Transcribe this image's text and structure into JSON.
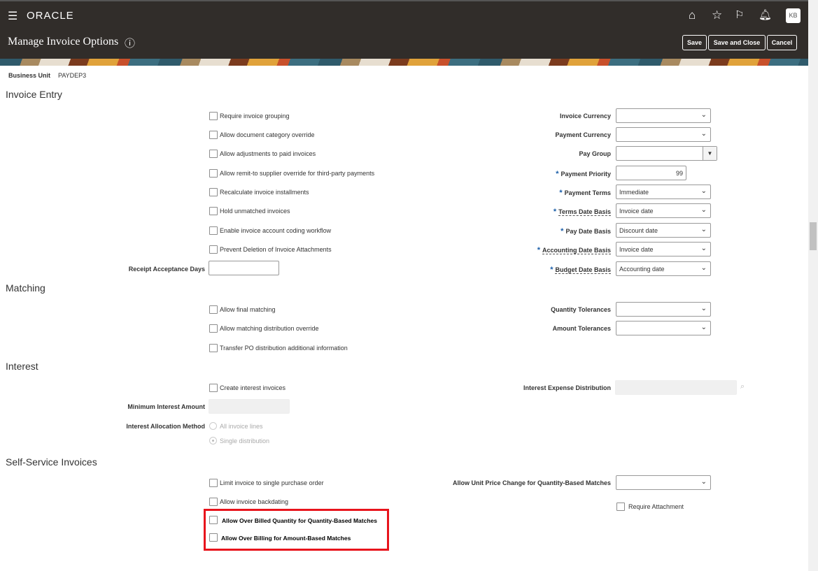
{
  "header": {
    "brand": "ORACLE",
    "title": "Manage Invoice Options",
    "avatar": "KB",
    "buttons": {
      "save": "Save",
      "save_close": "Save and Close",
      "cancel": "Cancel"
    }
  },
  "business_unit": {
    "label": "Business Unit",
    "value": "PAYDEP3"
  },
  "invoice_entry": {
    "title": "Invoice Entry",
    "checkboxes": [
      "Require invoice grouping",
      "Allow document category override",
      "Allow adjustments to paid invoices",
      "Allow remit-to supplier override for third-party payments",
      "Recalculate invoice installments",
      "Hold unmatched invoices",
      "Enable invoice account coding workflow",
      "Prevent Deletion of Invoice Attachments"
    ],
    "receipt_acceptance_days": {
      "label": "Receipt Acceptance Days",
      "value": ""
    },
    "fields": [
      {
        "label": "Invoice Currency",
        "value": "",
        "required": false
      },
      {
        "label": "Payment Currency",
        "value": "",
        "required": false
      },
      {
        "label": "Pay Group",
        "value": "",
        "required": false
      },
      {
        "label": "Payment Priority",
        "value": "99",
        "required": true
      },
      {
        "label": "Payment Terms",
        "value": "Immediate",
        "required": true
      },
      {
        "label": "Terms Date Basis",
        "value": "Invoice date",
        "required": true
      },
      {
        "label": "Pay Date Basis",
        "value": "Discount date",
        "required": true
      },
      {
        "label": "Accounting Date Basis",
        "value": "Invoice date",
        "required": true
      },
      {
        "label": "Budget Date Basis",
        "value": "Accounting date",
        "required": true
      }
    ]
  },
  "matching": {
    "title": "Matching",
    "checkboxes": [
      "Allow final matching",
      "Allow matching distribution override",
      "Transfer PO distribution additional information"
    ],
    "fields": [
      {
        "label": "Quantity Tolerances",
        "value": ""
      },
      {
        "label": "Amount Tolerances",
        "value": ""
      }
    ]
  },
  "interest": {
    "title": "Interest",
    "checkbox": "Create interest invoices",
    "min_amount_label": "Minimum Interest Amount",
    "allocation_label": "Interest Allocation Method",
    "allocation_options": [
      "All invoice lines",
      "Single distribution"
    ],
    "allocation_selected": "Single distribution",
    "expense_label": "Interest Expense Distribution"
  },
  "self_service": {
    "title": "Self-Service Invoices",
    "checkboxes": [
      "Limit invoice to single purchase order",
      "Allow invoice backdating"
    ],
    "highlighted": [
      "Allow Over Billed Quantity for Quantity-Based Matches",
      "Allow Over Billing for Amount-Based Matches"
    ],
    "unit_price_label": "Allow Unit Price Change for Quantity-Based Matches",
    "unit_price_value": "",
    "require_attachment": "Require Attachment"
  },
  "colors": {
    "header": "#312d2a",
    "highlight": "#e8141c",
    "required": "#1a5ea8"
  }
}
